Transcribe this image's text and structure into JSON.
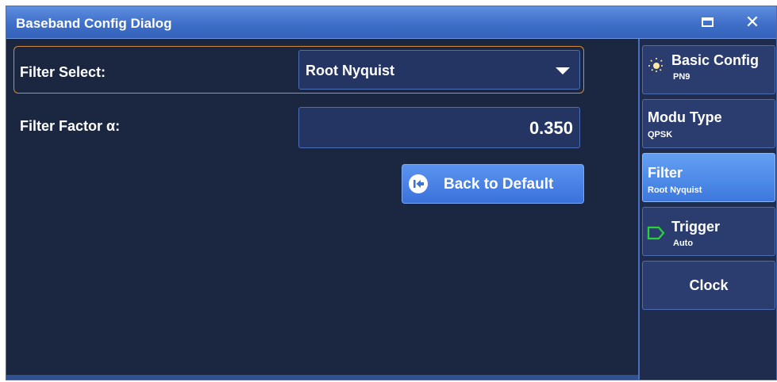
{
  "window": {
    "title": "Baseband Config Dialog"
  },
  "form": {
    "filter_select_label": "Filter Select:",
    "filter_select_value": "Root Nyquist",
    "filter_factor_label": "Filter Factor α:",
    "filter_factor_value": "0.350",
    "back_to_default_label": "Back to Default"
  },
  "sidebar": {
    "items": [
      {
        "title": "Basic Config",
        "subtitle": "PN9",
        "icon": "sun-icon",
        "active": false
      },
      {
        "title": "Modu Type",
        "subtitle": "QPSK",
        "icon": "",
        "active": false
      },
      {
        "title": "Filter",
        "subtitle": "Root Nyquist",
        "icon": "",
        "active": true
      },
      {
        "title": "Trigger",
        "subtitle": "Auto",
        "icon": "trigger-arrow-icon",
        "active": false
      },
      {
        "title": "Clock",
        "subtitle": "",
        "icon": "",
        "active": false
      }
    ]
  },
  "colors": {
    "background": "#1b2641",
    "titlebar": "#3f6fc8",
    "accent_button": "#3a72dc",
    "active_tab": "#4f8cea",
    "select_highlight_border": "#d28a3c",
    "trigger_icon": "#2ad13a",
    "sun_icon": "#ffe9a0"
  }
}
